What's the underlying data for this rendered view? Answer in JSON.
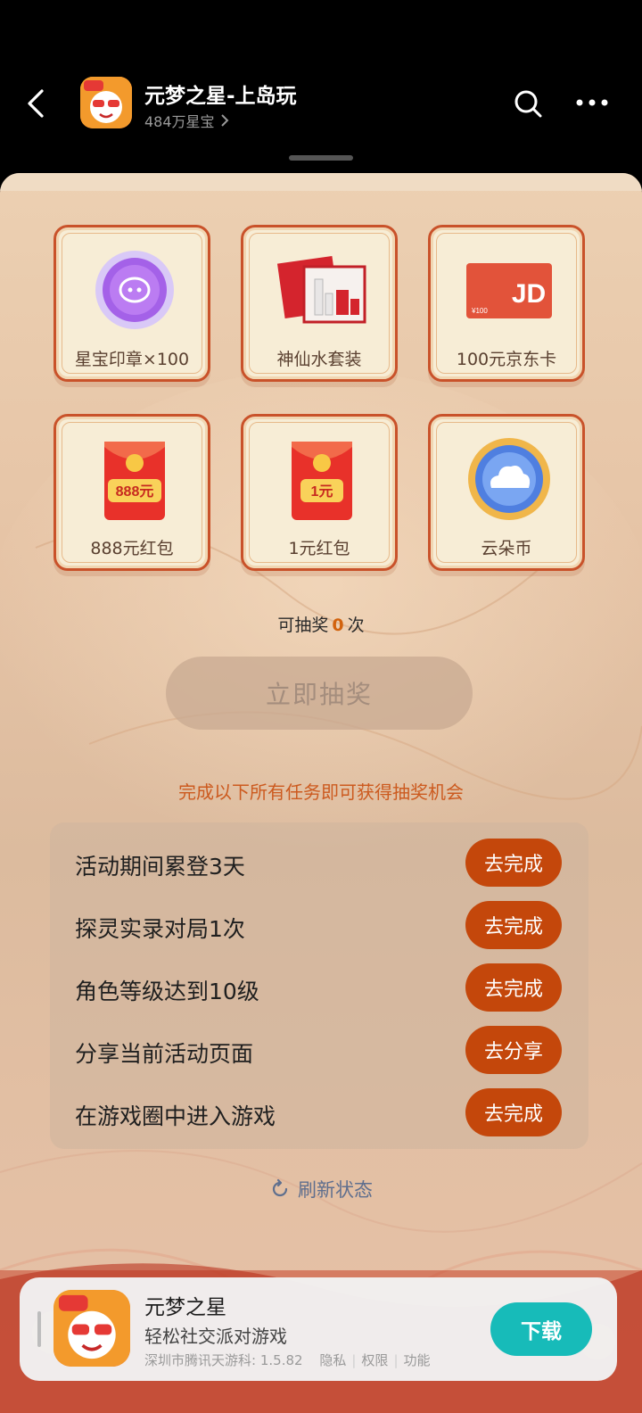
{
  "header": {
    "title": "元梦之星-上岛玩",
    "subtitle": "484万星宝",
    "chevron": "›"
  },
  "prizes": [
    {
      "label": "星宝印章×100",
      "icon": "seal-icon"
    },
    {
      "label": "神仙水套装",
      "icon": "skincare-set-icon"
    },
    {
      "label": "100元京东卡",
      "icon": "jd-card-icon"
    },
    {
      "label": "888元红包",
      "icon": "red-envelope-icon",
      "amount_text": "888元"
    },
    {
      "label": "1元红包",
      "icon": "red-envelope-icon",
      "amount_text": "1元"
    },
    {
      "label": "云朵币",
      "icon": "cloud-coin-icon"
    }
  ],
  "jd_card": {
    "logo_text": "JD",
    "value_text": "¥100"
  },
  "draw": {
    "count_prefix": "可抽奖",
    "count": "0",
    "count_suffix": "次",
    "button": "立即抽奖"
  },
  "tasks": {
    "hint": "完成以下所有任务即可获得抽奖机会",
    "items": [
      {
        "label": "活动期间累登3天",
        "action": "去完成"
      },
      {
        "label": "探灵实录对局1次",
        "action": "去完成"
      },
      {
        "label": "角色等级达到10级",
        "action": "去完成"
      },
      {
        "label": "分享当前活动页面",
        "action": "去分享"
      },
      {
        "label": "在游戏圈中进入游戏",
        "action": "去完成"
      }
    ]
  },
  "refresh": {
    "label": "刷新状态"
  },
  "download_card": {
    "name": "元梦之星",
    "desc": "轻松社交派对游戏",
    "developer": "深圳市腾讯天游科",
    "version": "1.5.82",
    "privacy": "隐私",
    "permissions": "权限",
    "features": "功能",
    "button": "下载"
  },
  "colors": {
    "accent_orange": "#c4470b",
    "download_teal": "#17bbb9",
    "count_orange": "#d2620d"
  }
}
